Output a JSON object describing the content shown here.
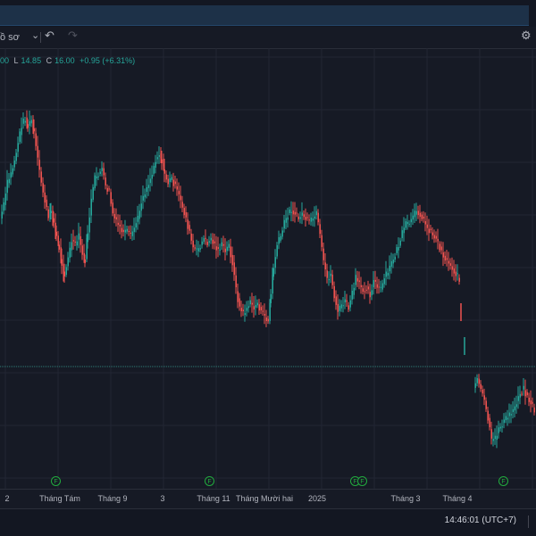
{
  "toolbar": {
    "chart_type_label": "ồ sơ",
    "dropdown_glyph": "⌄",
    "undo_glyph": "↶",
    "redo_glyph": "↷",
    "settings_glyph": "⚙"
  },
  "legend": {
    "open_value": "00",
    "low_key": "L",
    "low_value": "14.85",
    "close_key": "C",
    "close_value": "16.00",
    "change": "+0.95 (+6.31%)"
  },
  "xaxis": {
    "ticks": [
      {
        "label": "2"
      },
      {
        "label": "Tháng Tám"
      },
      {
        "label": "Tháng 9"
      },
      {
        "label": "3"
      },
      {
        "label": "Tháng 11"
      },
      {
        "label": "Tháng Mười hai"
      },
      {
        "label": "2025"
      },
      {
        "label": "Tháng 3"
      },
      {
        "label": "Tháng 4"
      }
    ]
  },
  "dividend_marker_label": "F",
  "status": {
    "clock": "14:46:01 (UTC+7)"
  },
  "colors": {
    "up": "#26a69a",
    "down": "#ef5350",
    "grid": "#222633",
    "marker": "#22ab3e"
  },
  "chart_data": {
    "type": "candlestick",
    "series_path": [
      [
        0,
        245
      ],
      [
        4,
        230
      ],
      [
        8,
        205
      ],
      [
        12,
        195
      ],
      [
        16,
        180
      ],
      [
        20,
        160
      ],
      [
        24,
        140
      ],
      [
        28,
        132
      ],
      [
        31,
        142
      ],
      [
        35,
        135
      ],
      [
        38,
        150
      ],
      [
        42,
        180
      ],
      [
        46,
        205
      ],
      [
        50,
        225
      ],
      [
        54,
        245
      ],
      [
        57,
        235
      ],
      [
        60,
        250
      ],
      [
        63,
        265
      ],
      [
        66,
        278
      ],
      [
        69,
        295
      ],
      [
        72,
        308
      ],
      [
        76,
        290
      ],
      [
        80,
        270
      ],
      [
        84,
        275
      ],
      [
        88,
        265
      ],
      [
        92,
        285
      ],
      [
        95,
        292
      ],
      [
        98,
        260
      ],
      [
        102,
        225
      ],
      [
        106,
        200
      ],
      [
        110,
        195
      ],
      [
        114,
        190
      ],
      [
        118,
        210
      ],
      [
        122,
        215
      ],
      [
        126,
        240
      ],
      [
        130,
        250
      ],
      [
        134,
        255
      ],
      [
        138,
        262
      ],
      [
        142,
        260
      ],
      [
        146,
        265
      ],
      [
        150,
        255
      ],
      [
        154,
        245
      ],
      [
        158,
        225
      ],
      [
        162,
        215
      ],
      [
        166,
        205
      ],
      [
        170,
        195
      ],
      [
        174,
        178
      ],
      [
        178,
        172
      ],
      [
        181,
        180
      ],
      [
        184,
        195
      ],
      [
        188,
        205
      ],
      [
        192,
        200
      ],
      [
        196,
        210
      ],
      [
        200,
        220
      ],
      [
        204,
        232
      ],
      [
        208,
        245
      ],
      [
        212,
        262
      ],
      [
        216,
        278
      ],
      [
        220,
        282
      ],
      [
        224,
        275
      ],
      [
        228,
        268
      ],
      [
        232,
        272
      ],
      [
        236,
        268
      ],
      [
        240,
        275
      ],
      [
        244,
        280
      ],
      [
        248,
        275
      ],
      [
        252,
        282
      ],
      [
        256,
        275
      ],
      [
        260,
        295
      ],
      [
        264,
        325
      ],
      [
        268,
        345
      ],
      [
        272,
        352
      ],
      [
        276,
        345
      ],
      [
        280,
        340
      ],
      [
        284,
        345
      ],
      [
        288,
        340
      ],
      [
        292,
        350
      ],
      [
        296,
        355
      ],
      [
        300,
        360
      ],
      [
        303,
        330
      ],
      [
        306,
        300
      ],
      [
        310,
        275
      ],
      [
        314,
        265
      ],
      [
        318,
        250
      ],
      [
        322,
        240
      ],
      [
        326,
        235
      ],
      [
        330,
        240
      ],
      [
        334,
        245
      ],
      [
        338,
        240
      ],
      [
        342,
        245
      ],
      [
        346,
        250
      ],
      [
        350,
        245
      ],
      [
        354,
        240
      ],
      [
        358,
        265
      ],
      [
        362,
        295
      ],
      [
        366,
        312
      ],
      [
        370,
        308
      ],
      [
        374,
        332
      ],
      [
        378,
        350
      ],
      [
        382,
        342
      ],
      [
        386,
        338
      ],
      [
        390,
        345
      ],
      [
        394,
        330
      ],
      [
        398,
        312
      ],
      [
        402,
        320
      ],
      [
        406,
        325
      ],
      [
        410,
        322
      ],
      [
        414,
        330
      ],
      [
        418,
        315
      ],
      [
        422,
        322
      ],
      [
        426,
        325
      ],
      [
        430,
        312
      ],
      [
        434,
        305
      ],
      [
        438,
        295
      ],
      [
        442,
        285
      ],
      [
        446,
        275
      ],
      [
        450,
        262
      ],
      [
        454,
        252
      ],
      [
        458,
        250
      ],
      [
        462,
        245
      ],
      [
        466,
        235
      ],
      [
        470,
        240
      ],
      [
        474,
        248
      ],
      [
        478,
        255
      ],
      [
        482,
        260
      ],
      [
        486,
        265
      ],
      [
        490,
        272
      ],
      [
        494,
        282
      ],
      [
        498,
        290
      ],
      [
        502,
        295
      ],
      [
        506,
        300
      ],
      [
        510,
        308
      ],
      [
        514,
        312
      ]
    ],
    "series_path_2": [
      [
        530,
        435
      ],
      [
        534,
        425
      ],
      [
        538,
        438
      ],
      [
        542,
        450
      ],
      [
        546,
        470
      ],
      [
        550,
        495
      ],
      [
        554,
        492
      ],
      [
        558,
        480
      ],
      [
        562,
        475
      ],
      [
        566,
        470
      ],
      [
        570,
        465
      ],
      [
        574,
        460
      ],
      [
        578,
        450
      ],
      [
        582,
        440
      ],
      [
        586,
        436
      ],
      [
        590,
        445
      ],
      [
        594,
        452
      ],
      [
        598,
        460
      ]
    ],
    "isolated_ticks": [
      [
        516,
        350
      ],
      [
        520,
        388
      ]
    ],
    "current_price_line_y": 411,
    "dividend_markers_x": [
      62,
      234,
      397,
      405,
      563
    ],
    "xaxis_tick_x": [
      8,
      67,
      126,
      182,
      239,
      296,
      355,
      454,
      512
    ]
  }
}
